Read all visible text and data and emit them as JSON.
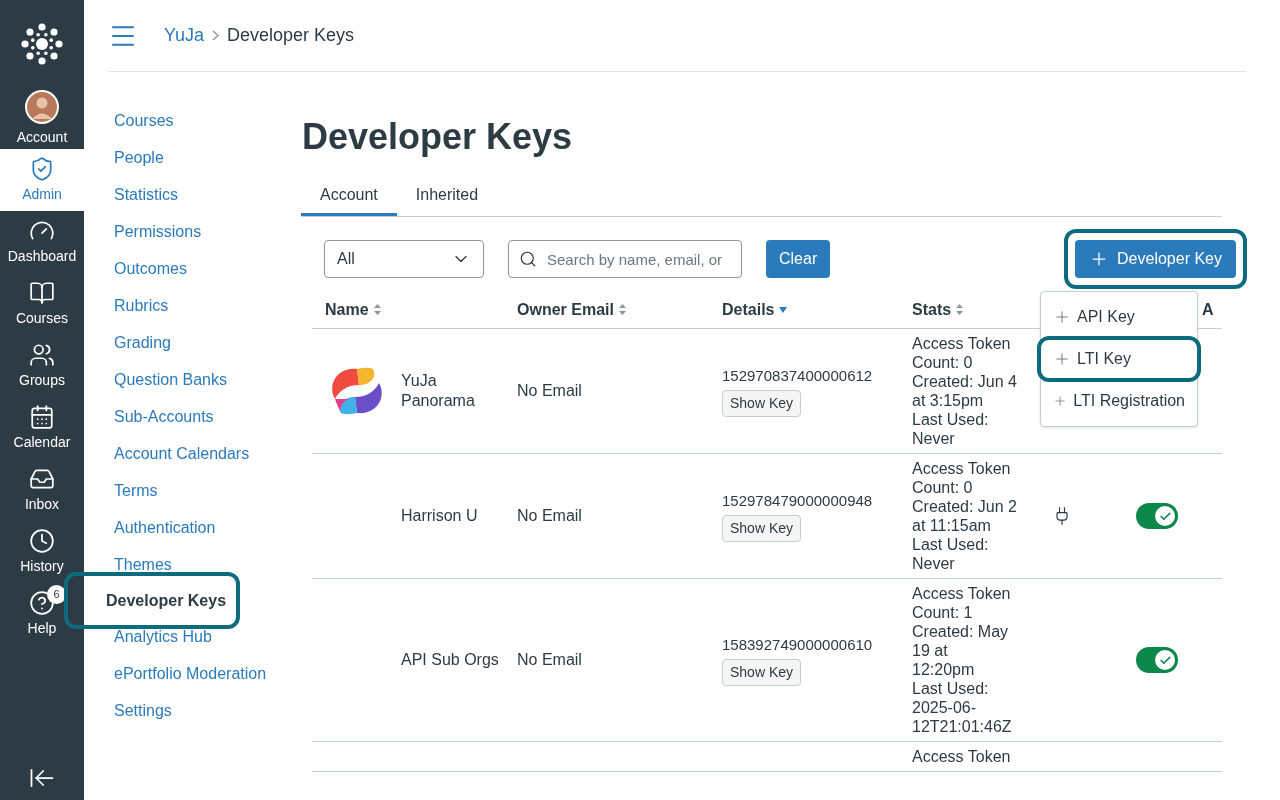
{
  "global_nav": [
    {
      "label": "Account",
      "kind": "avatar",
      "selected": false
    },
    {
      "label": "Admin",
      "kind": "admin",
      "selected": true
    },
    {
      "label": "Dashboard",
      "kind": "dashboard",
      "selected": false
    },
    {
      "label": "Courses",
      "kind": "courses",
      "selected": false
    },
    {
      "label": "Groups",
      "kind": "groups",
      "selected": false
    },
    {
      "label": "Calendar",
      "kind": "calendar",
      "selected": false
    },
    {
      "label": "Inbox",
      "kind": "inbox",
      "selected": false
    },
    {
      "label": "History",
      "kind": "history",
      "selected": false
    },
    {
      "label": "Help",
      "kind": "help",
      "selected": false,
      "badge": "6"
    }
  ],
  "breadcrumb": [
    "YuJa",
    "Developer Keys"
  ],
  "sidebar": {
    "items": [
      {
        "label": "Courses",
        "selected": false,
        "highlighted": false
      },
      {
        "label": "People",
        "selected": false,
        "highlighted": false
      },
      {
        "label": "Statistics",
        "selected": false,
        "highlighted": false
      },
      {
        "label": "Permissions",
        "selected": false,
        "highlighted": false
      },
      {
        "label": "Outcomes",
        "selected": false,
        "highlighted": false
      },
      {
        "label": "Rubrics",
        "selected": false,
        "highlighted": false
      },
      {
        "label": "Grading",
        "selected": false,
        "highlighted": false
      },
      {
        "label": "Question Banks",
        "selected": false,
        "highlighted": false
      },
      {
        "label": "Sub-Accounts",
        "selected": false,
        "highlighted": false
      },
      {
        "label": "Account Calendars",
        "selected": false,
        "highlighted": false
      },
      {
        "label": "Terms",
        "selected": false,
        "highlighted": false
      },
      {
        "label": "Authentication",
        "selected": false,
        "highlighted": false
      },
      {
        "label": "Themes",
        "selected": false,
        "highlighted": false
      },
      {
        "label": "Developer Keys",
        "selected": true,
        "highlighted": true
      },
      {
        "label": "Analytics Hub",
        "selected": false,
        "highlighted": false
      },
      {
        "label": "ePortfolio Moderation",
        "selected": false,
        "highlighted": false
      },
      {
        "label": "Settings",
        "selected": false,
        "highlighted": false
      }
    ]
  },
  "page_title": "Developer Keys",
  "tabs": [
    {
      "label": "Account",
      "selected": true
    },
    {
      "label": "Inherited",
      "selected": false
    }
  ],
  "filter": {
    "value": "All"
  },
  "search": {
    "placeholder": "Search by name, email, or"
  },
  "clear_button": "Clear",
  "add_button": {
    "label": "Developer Key",
    "highlighted": true
  },
  "add_menu": [
    {
      "label": "API Key",
      "highlighted": false
    },
    {
      "label": "LTI Key",
      "highlighted": true
    },
    {
      "label": "LTI Registration",
      "highlighted": false
    }
  ],
  "table": {
    "columns": [
      {
        "label": "Name",
        "sortable": true,
        "sorted": false
      },
      {
        "label": "Owner Email",
        "sortable": true,
        "sorted": false
      },
      {
        "label": "Details",
        "sortable": true,
        "sorted": true
      },
      {
        "label": "Stats",
        "sortable": true,
        "sorted": false
      },
      {
        "label": "A"
      }
    ],
    "rows": [
      {
        "logo": true,
        "name": "YuJa Panorama",
        "email": "No Email",
        "id": "152970837400000612",
        "show_key": "Show Key",
        "stats": [
          "Access Token",
          "Count: 0",
          "Created: Jun 4",
          "at 3:15pm",
          "Last Used:",
          "Never"
        ],
        "lti": false
      },
      {
        "logo": false,
        "name": "Harrison U",
        "email": "No Email",
        "id": "152978479000000948",
        "show_key": "Show Key",
        "stats": [
          "Access Token",
          "Count: 0",
          "Created: Jun 2",
          "at 11:15am",
          "Last Used:",
          "Never"
        ],
        "lti": true,
        "on": true
      },
      {
        "logo": false,
        "name": "API Sub Orgs",
        "email": "No Email",
        "id": "158392749000000610",
        "show_key": "Show Key",
        "stats": [
          "Access Token",
          "Count: 1",
          "Created: May",
          "19 at",
          "12:20pm",
          "Last Used:",
          "2025-06-",
          "12T21:01:46Z"
        ],
        "lti": false,
        "on": true
      },
      {
        "stats": [
          "Access Token"
        ]
      }
    ]
  }
}
